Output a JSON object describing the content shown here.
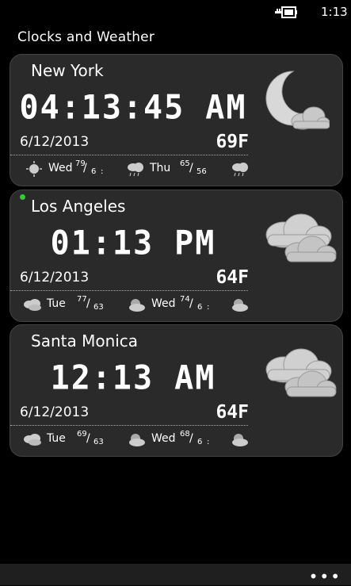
{
  "status": {
    "time": "1:13"
  },
  "app": {
    "title": "Clocks and Weather",
    "more": "•••"
  },
  "cards": [
    {
      "city": "New York",
      "time": "04:13:45 AM",
      "date": "6/12/2013",
      "temp": "69F",
      "condition_icon": "moon-cloud-icon",
      "forecast": [
        {
          "icon": "sun-icon",
          "day": "Wed",
          "hi": "79",
          "lo": "6",
          "extra": ":"
        },
        {
          "icon": "rain-cloud-icon",
          "day": "Thu",
          "hi": "65",
          "lo": "56",
          "extra": ""
        },
        {
          "icon": "rain-cloud-icon",
          "day": "",
          "hi": "",
          "lo": "",
          "extra": ""
        }
      ]
    },
    {
      "city": "Los Angeles",
      "time": "01:13 PM",
      "date": "6/12/2013",
      "temp": "64F",
      "condition_icon": "cloudy-icon",
      "forecast": [
        {
          "icon": "cloudy-icon",
          "day": "Tue",
          "hi": "77",
          "lo": "63",
          "extra": ""
        },
        {
          "icon": "partly-cloudy-icon",
          "day": "Wed",
          "hi": "74",
          "lo": "6",
          "extra": ":"
        },
        {
          "icon": "partly-cloudy-icon",
          "day": "",
          "hi": "",
          "lo": "",
          "extra": ""
        }
      ]
    },
    {
      "city": "Santa Monica",
      "time": "12:13 AM",
      "date": "6/12/2013",
      "temp": "64F",
      "condition_icon": "cloudy-icon",
      "forecast": [
        {
          "icon": "cloudy-icon",
          "day": "Tue",
          "hi": "69",
          "lo": "63",
          "extra": ""
        },
        {
          "icon": "partly-cloudy-icon",
          "day": "Wed",
          "hi": "68",
          "lo": "6",
          "extra": ":"
        },
        {
          "icon": "partly-cloudy-icon",
          "day": "",
          "hi": "",
          "lo": "",
          "extra": ""
        }
      ]
    }
  ]
}
